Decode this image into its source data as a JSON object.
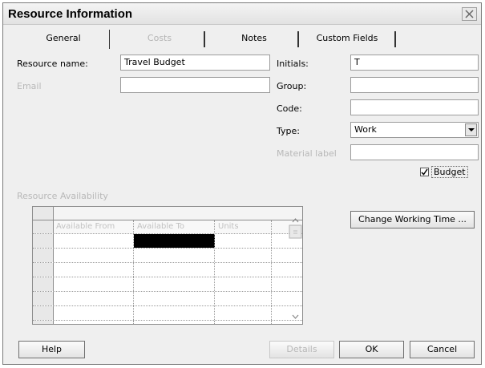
{
  "dialog": {
    "title": "Resource Information"
  },
  "tabs": [
    {
      "label": "General",
      "active": true,
      "disabled": false
    },
    {
      "label": "Costs",
      "active": false,
      "disabled": true
    },
    {
      "label": "Notes",
      "active": false,
      "disabled": false
    },
    {
      "label": "Custom Fields",
      "active": false,
      "disabled": false
    }
  ],
  "form": {
    "resource_name": {
      "label": "Resource name:",
      "value": "Travel Budget"
    },
    "email": {
      "label": "Email",
      "value": ""
    },
    "initials": {
      "label": "Initials:",
      "value": "T"
    },
    "group": {
      "label": "Group:",
      "value": ""
    },
    "code": {
      "label": "Code:",
      "value": ""
    },
    "type": {
      "label": "Type:",
      "value": "Work"
    },
    "material_label": {
      "label": "Material label",
      "value": ""
    },
    "budget": {
      "label": "Budget",
      "checked": true
    }
  },
  "availability": {
    "section_label": "Resource Availability",
    "columns": [
      "Available From",
      "Available To",
      "Units"
    ],
    "rows": 7
  },
  "buttons": {
    "change_working_time": "Change Working Time ...",
    "help": "Help",
    "details": "Details",
    "ok": "OK",
    "cancel": "Cancel"
  }
}
